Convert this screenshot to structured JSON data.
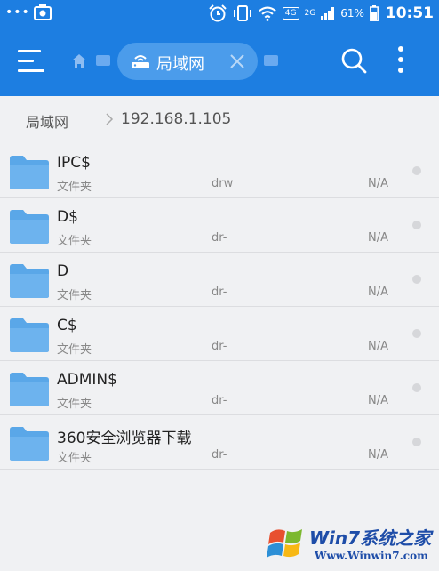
{
  "status_bar": {
    "dots": "•••",
    "network_badge": "4G",
    "network2": "2G",
    "battery": "61%",
    "time": "10:51"
  },
  "app_bar": {
    "active_tab_label": "局域网",
    "icons": [
      "menu-icon",
      "home-icon",
      "lan-icon",
      "close-icon",
      "search-icon",
      "more-vert-icon"
    ],
    "color": "#1d7ee1"
  },
  "breadcrumb": {
    "root": "局域网",
    "current": "192.168.1.105"
  },
  "files": [
    {
      "name": "IPC$",
      "type": "文件夹",
      "perm": "drw",
      "size": "N/A"
    },
    {
      "name": "D$",
      "type": "文件夹",
      "perm": "dr-",
      "size": "N/A"
    },
    {
      "name": "D",
      "type": "文件夹",
      "perm": "dr-",
      "size": "N/A"
    },
    {
      "name": "C$",
      "type": "文件夹",
      "perm": "dr-",
      "size": "N/A"
    },
    {
      "name": "ADMIN$",
      "type": "文件夹",
      "perm": "dr-",
      "size": "N/A"
    },
    {
      "name": "360安全浏览器下载",
      "type": "文件夹",
      "perm": "dr-",
      "size": "N/A"
    }
  ],
  "watermark": {
    "title": "Win7系统之家",
    "url": "Www.Winwin7.com"
  }
}
